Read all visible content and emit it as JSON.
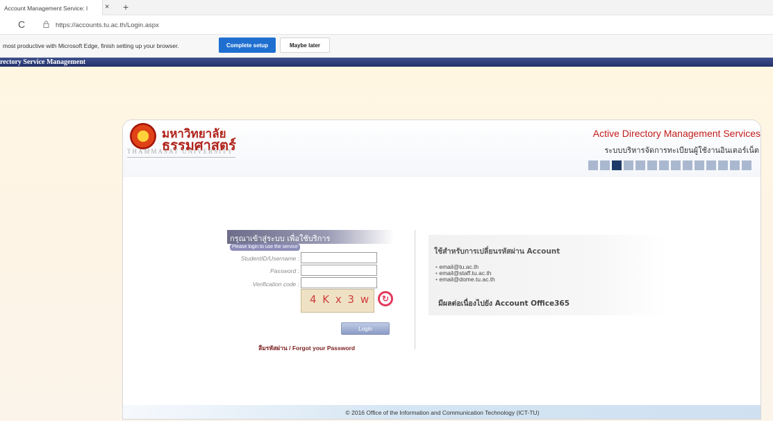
{
  "browser": {
    "tab_title": "Account Management Service: l",
    "tab_close": "×",
    "new_tab": "+",
    "reload": "C",
    "url": "https://accounts.tu.ac.th/Login.aspx",
    "infobar": {
      "message": "most productive with Microsoft Edge, finish setting up your browser.",
      "complete_label": "Complete setup",
      "later_label": "Maybe later"
    }
  },
  "page": {
    "header_text": "rectory Service Management",
    "logo": {
      "thai_line1": "มหาวิทยาลัย",
      "thai_line2": "ธรรมศาสตร์",
      "english": "THAMMASAT UNIVERSITY"
    },
    "title_en": "Active Directory Management Services",
    "title_th": "ระบบบริหารจัดการทะเบียนผู้ใช้งานอินเตอร์เน็ต",
    "login": {
      "heading": "กรุณาเข้าสู่ระบบ เพื่อใช้บริการ",
      "subheading": "Please login to use the service",
      "username_label": "StudentID/Username :",
      "password_label": "Password :",
      "verification_label": "Verification code :",
      "captcha_text": "4 K x 3 w",
      "refresh_symbol": "↻",
      "login_button": "Login",
      "forgot_link": "ลืมรหัสผ่าน / Forgot your Password"
    },
    "info": {
      "title": "ใช้สำหรับการเปลี่ยนรหัสผ่าน Account",
      "emails": [
        "email@tu.ac.th",
        "email@staff.tu.ac.th",
        "email@dome.tu.ac.th"
      ],
      "note": "มีผลต่อเนื่องไปยัง Account Office365"
    },
    "footer": "© 2016 Office of the Information and Communication Technology (ICT-TU)"
  }
}
